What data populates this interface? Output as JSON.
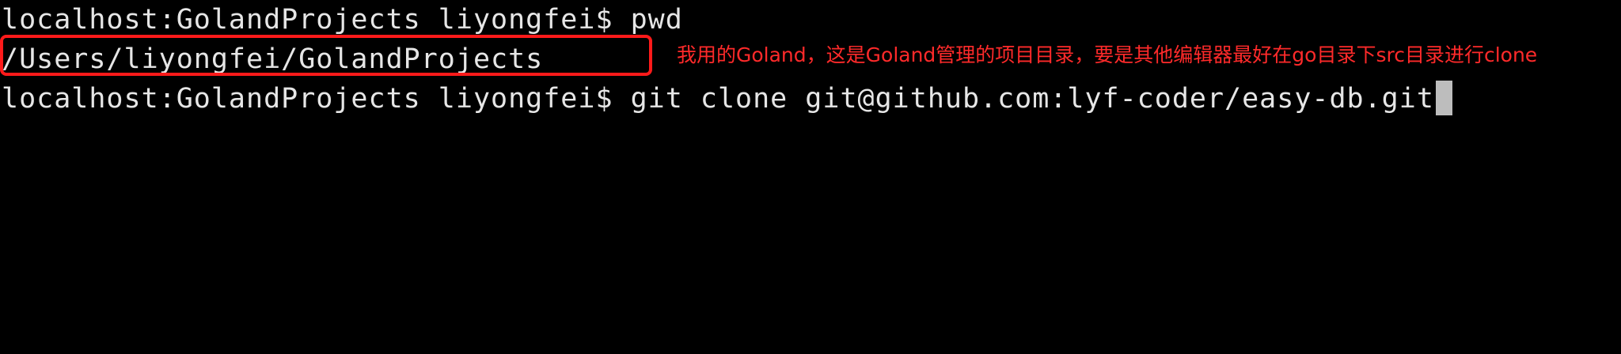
{
  "terminal": {
    "line1": {
      "prompt": "localhost:GolandProjects liyongfei$ ",
      "command": "pwd"
    },
    "line2": {
      "output": "/Users/liyongfei/GolandProjects"
    },
    "line3": {
      "prompt": "localhost:GolandProjects liyongfei$ ",
      "command": "git clone git@github.com:lyf-coder/easy-db.git"
    }
  },
  "annotation": {
    "text": "我用的Goland，这是Goland管理的项目目录，要是其他编辑器最好在go目录下src目录进行clone",
    "color": "#ff2a2a"
  },
  "colors": {
    "background": "#000000",
    "text": "#e6e6e6",
    "highlight_border": "#ff1a1a",
    "cursor": "#bdbdbd"
  }
}
